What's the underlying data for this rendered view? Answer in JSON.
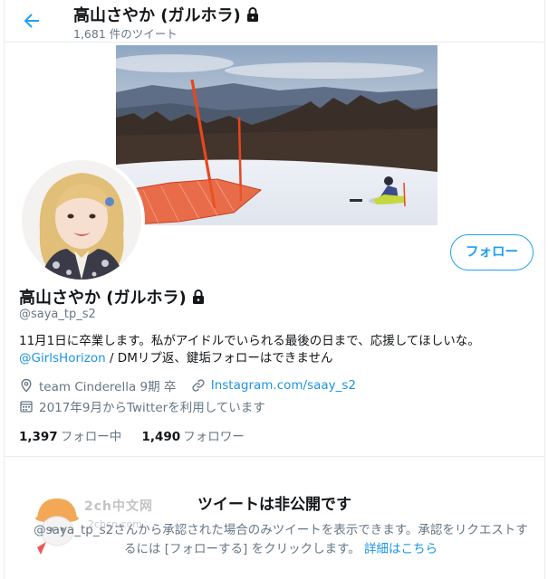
{
  "header": {
    "title": "高山さやか (ガルホラ)",
    "tweet_count": "1,681 件のツイート"
  },
  "profile": {
    "name": "高山さやか (ガルホラ)",
    "handle": "@saya_tp_s2",
    "follow_label": "フォロー",
    "bio_line1": "11月1日に卒業します。私がアイドルでいられる最後の日まで、応援してほしいな。",
    "bio_mention": "@GirlsHorizon",
    "bio_line2_rest": " / DMリプ返、鍵垢フォローはできません",
    "location": "team Cinderella 9期 卒",
    "website": "Instagram.com/saay_s2",
    "joined": "2017年9月からTwitterを利用しています",
    "following_count": "1,397",
    "following_label": "フォロー中",
    "followers_count": "1,490",
    "followers_label": "フォロワー"
  },
  "protected": {
    "title": "ツイートは非公開です",
    "body": "@saya_tp_s2さんから承認された場合のみツイートを表示できます。承認をリクエストするには [フォローする] をクリックします。",
    "learn_more": "詳細はこちら"
  },
  "watermark": {
    "text": "2ch中文网",
    "sub": "2chcn.com"
  },
  "colors": {
    "accent": "#1da1f2",
    "link": "#1b95e0",
    "secondary_text": "#657786",
    "border": "#e6ecf0"
  },
  "icons": [
    "back-arrow-icon",
    "lock-icon",
    "location-icon",
    "link-icon",
    "calendar-icon"
  ]
}
